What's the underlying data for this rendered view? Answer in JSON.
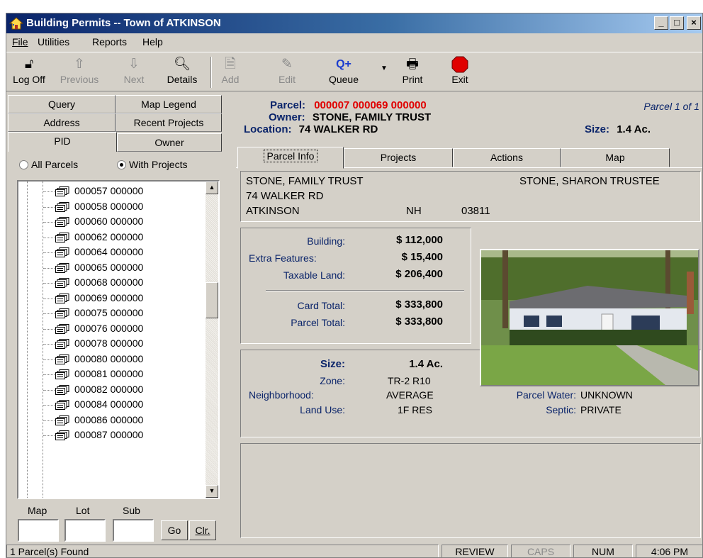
{
  "window": {
    "title": "Building Permits -- Town of ATKINSON",
    "controls": {
      "minimize": "_",
      "maximize": "□",
      "close": "×"
    }
  },
  "menu": [
    "File",
    "Utilities",
    "Reports",
    "Help"
  ],
  "toolbar": {
    "log_off": "Log Off",
    "previous": "Previous",
    "next": "Next",
    "details": "Details",
    "add": "Add",
    "edit": "Edit",
    "queue": "Queue",
    "print": "Print",
    "exit": "Exit"
  },
  "left_tabs": {
    "query": "Query",
    "map_legend": "Map Legend",
    "address": "Address",
    "recent_projects": "Recent Projects",
    "pid": "PID",
    "owner": "Owner"
  },
  "filter": {
    "all_parcels": "All Parcels",
    "with_projects": "With Projects",
    "selected": "with_projects"
  },
  "tree_items": [
    "000057  000000",
    "000058  000000",
    "000060  000000",
    "000062  000000",
    "000064  000000",
    "000065  000000",
    "000068  000000",
    "000069  000000",
    "000075  000000",
    "000076  000000",
    "000078  000000",
    "000080  000000",
    "000081  000000",
    "000082  000000",
    "000084  000000",
    "000086  000000",
    "000087  000000"
  ],
  "map_lot_sub": {
    "map_label": "Map",
    "lot_label": "Lot",
    "sub_label": "Sub",
    "go": "Go",
    "clear": "Clr."
  },
  "header": {
    "parcel_label": "Parcel:",
    "parcel_value": "000007  000069  000000",
    "owner_label": "Owner:",
    "owner_value": "STONE, FAMILY TRUST",
    "location_label": "Location:",
    "location_value": "74 WALKER RD",
    "size_label": "Size:",
    "size_value": "1.4 Ac.",
    "parcel_count": "Parcel 1 of 1"
  },
  "right_tabs": [
    "Parcel Info",
    "Projects",
    "Actions",
    "Map"
  ],
  "owner_block": {
    "name": "STONE, FAMILY TRUST",
    "co_owner": "STONE, SHARON TRUSTEE",
    "street": "74 WALKER RD",
    "city": "ATKINSON",
    "state": "NH",
    "zip": "03811"
  },
  "valuation": {
    "building_label": "Building:",
    "building_value": "$ 112,000",
    "extra_label": "Extra Features:",
    "extra_value": "$ 15,400",
    "land_label": "Taxable Land:",
    "land_value": "$ 206,400",
    "card_label": "Card Total:",
    "card_value": "$ 333,800",
    "parcel_label": "Parcel Total:",
    "parcel_value": "$ 333,800"
  },
  "land": {
    "size_label": "Size:",
    "size_value": "1.4 Ac.",
    "zone_label": "Zone:",
    "zone_value": "TR-2 R10",
    "neighborhood_label": "Neighborhood:",
    "neighborhood_value": "AVERAGE",
    "land_use_label": "Land Use:",
    "land_use_value": "1F RES",
    "water_label": "Parcel Water:",
    "water_value": "UNKNOWN",
    "septic_label": "Septic:",
    "septic_value": "PRIVATE"
  },
  "status": {
    "message": "1 Parcel(s) Found",
    "mode": "REVIEW",
    "caps": "CAPS",
    "num": "NUM",
    "time": "4:06 PM"
  },
  "colors": {
    "title_gradient_start": "#0a246a",
    "title_gradient_end": "#a6caf0",
    "face": "#d4d0c8",
    "label_blue": "#0a246a",
    "parcel_red": "#e00000",
    "exit_red": "#e00000",
    "queue_blue": "#1a3ccf"
  }
}
